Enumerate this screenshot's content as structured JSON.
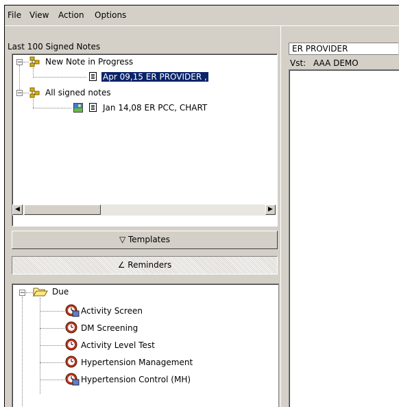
{
  "menu": [
    "File",
    "View",
    "Action",
    "Options"
  ],
  "left": {
    "title": "Last 100 Signed Notes",
    "groups": [
      {
        "label": "New Note in Progress",
        "expander": "−",
        "items": [
          {
            "label": "Apr 09,15  ER PROVIDER ,",
            "selected": true
          }
        ]
      },
      {
        "label": "All signed notes",
        "expander": "−",
        "items": [
          {
            "label": "Jan 14,08  ER PCC, CHART",
            "selected": false
          }
        ]
      }
    ],
    "templates_label": "▽ Templates",
    "reminders_label": "∠ Reminders",
    "reminders": {
      "group": "Due",
      "expander": "−",
      "items": [
        "Activity Screen",
        "DM Screening",
        "Activity Level Test",
        "Hypertension Management",
        "Hypertension Control (MH)"
      ]
    }
  },
  "right": {
    "provider": "ER PROVIDER",
    "vst_label": "Vst:",
    "vst_value": "AAA DEMO"
  },
  "scroll": {
    "left_arrow": "◀",
    "right_arrow": "▶"
  }
}
